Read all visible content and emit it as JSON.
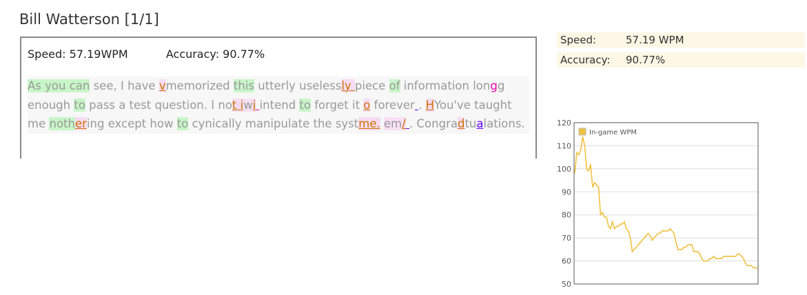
{
  "title": "Bill Watterson [1/1]",
  "stats": {
    "speed_label": "Speed:",
    "speed_value": " 57.19WPM",
    "accuracy_label": "Accuracy:",
    "accuracy_value": " 90.77%"
  },
  "passage": [
    [
      "As you can",
      "g"
    ],
    [
      " see, I have ",
      "n"
    ],
    [
      "v",
      "e"
    ],
    [
      "memorized ",
      "n"
    ],
    [
      "this",
      "g"
    ],
    [
      " utterly useless",
      "n"
    ],
    [
      "ly ",
      "e"
    ],
    [
      "piece ",
      "n"
    ],
    [
      "of",
      "g"
    ],
    [
      " information lon",
      "n"
    ],
    [
      "g",
      "m"
    ],
    [
      "g enough ",
      "n"
    ],
    [
      "to",
      "g"
    ],
    [
      " pass a test question. I no",
      "n"
    ],
    [
      "t i",
      "e"
    ],
    [
      "w",
      "p"
    ],
    [
      "i",
      "e"
    ],
    [
      " ",
      "m"
    ],
    [
      "intend ",
      "n"
    ],
    [
      "to",
      "g"
    ],
    [
      " forget it ",
      "n"
    ],
    [
      "o",
      "e"
    ],
    [
      " forever",
      "n"
    ],
    [
      " ",
      "b"
    ],
    [
      ". ",
      "n"
    ],
    [
      "H",
      "e"
    ],
    [
      "You've taught me ",
      "n"
    ],
    [
      "noth",
      "g"
    ],
    [
      "er",
      "e"
    ],
    [
      "ing except how ",
      "n"
    ],
    [
      "to",
      "g"
    ],
    [
      " cynically manipulate the syst",
      "n"
    ],
    [
      "me.",
      "e"
    ],
    [
      " ",
      "n"
    ],
    [
      "em",
      "p"
    ],
    [
      "/",
      "e"
    ],
    [
      " ",
      "b"
    ],
    [
      ". Congra",
      "n"
    ],
    [
      "d",
      "e"
    ],
    [
      "tu",
      "n"
    ],
    [
      "a",
      "b"
    ],
    [
      "lations.",
      "n"
    ]
  ],
  "summary": {
    "speed_label": "Speed:",
    "speed_value": "57.19 WPM",
    "accuracy_label": "Accuracy:",
    "accuracy_value": "90.77%"
  },
  "chart_data": {
    "type": "line",
    "series": [
      {
        "name": "In-game WPM",
        "color": "#f0c040",
        "values": [
          98,
          107,
          106,
          108,
          114,
          110,
          100,
          99,
          102,
          92,
          94,
          93,
          92,
          80,
          81,
          79,
          79,
          75,
          74,
          77,
          74,
          75,
          75,
          76,
          76,
          77,
          74,
          73,
          70,
          64,
          65,
          66,
          67,
          68,
          69,
          70,
          71,
          72,
          71,
          69,
          70,
          71,
          72,
          72,
          73,
          73,
          73,
          73,
          74,
          73,
          72,
          68,
          65,
          65,
          65,
          66,
          66,
          67,
          67,
          67,
          64,
          64,
          64,
          63,
          61,
          60,
          60,
          60,
          61,
          61,
          62,
          61,
          61,
          61,
          61,
          62,
          62,
          62,
          62,
          62,
          62,
          62,
          63,
          63,
          62,
          61,
          59,
          58,
          58,
          58,
          57,
          57,
          57
        ]
      }
    ],
    "ylim": [
      50,
      120
    ],
    "yticks": [
      "120",
      "110",
      "100",
      "90",
      "80",
      "70",
      "60",
      "50"
    ],
    "grid": true,
    "legend": "top-left"
  }
}
